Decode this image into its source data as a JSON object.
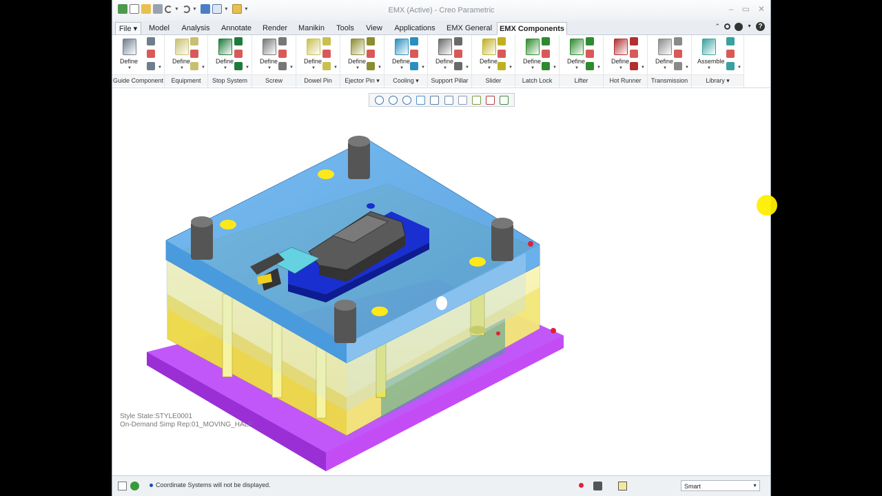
{
  "window": {
    "title": "EMX (Active) - Creo Parametric",
    "controls": [
      "–",
      "▭",
      "✕"
    ]
  },
  "quick_access": {
    "icons": [
      "app-icon",
      "new-icon",
      "open-icon",
      "save-icon",
      "undo-icon",
      "redo-icon",
      "regenerate-icon",
      "windows-icon",
      "close-window-icon",
      "customize-icon"
    ]
  },
  "menu_tabs": [
    {
      "label": "File ▾"
    },
    {
      "label": "Model"
    },
    {
      "label": "Analysis"
    },
    {
      "label": "Annotate"
    },
    {
      "label": "Render"
    },
    {
      "label": "Manikin"
    },
    {
      "label": "Tools"
    },
    {
      "label": "View"
    },
    {
      "label": "Applications"
    },
    {
      "label": "EMX General"
    },
    {
      "label": "EMX Components"
    }
  ],
  "active_tab": "EMX Components",
  "help": {
    "icons": [
      "minimize-ribbon-icon",
      "search-icon",
      "community-icon",
      "help-icon"
    ],
    "help_glyph": "?"
  },
  "ribbon": {
    "groups": [
      {
        "label": "Guide Component",
        "button": "Define",
        "color": "#6f7e8e"
      },
      {
        "label": "Equipment",
        "button": "Define",
        "color": "#c8c070"
      },
      {
        "label": "Stop System",
        "button": "Define",
        "color": "#1e7a3a"
      },
      {
        "label": "Screw",
        "button": "Define",
        "color": "#777777"
      },
      {
        "label": "Dowel Pin",
        "button": "Define",
        "color": "#c8c050"
      },
      {
        "label": "Ejector Pin ▾",
        "button": "Define",
        "color": "#8c8c30"
      },
      {
        "label": "Cooling ▾",
        "button": "Define",
        "color": "#2a8fbf"
      },
      {
        "label": "Support Pillar",
        "button": "Define",
        "color": "#6a6a6a"
      },
      {
        "label": "Slider",
        "button": "Define",
        "color": "#c0b020"
      },
      {
        "label": "Latch Lock",
        "button": "Define",
        "color": "#2e8a2e"
      },
      {
        "label": "Lifter",
        "button": "Define",
        "color": "#2e8a2e"
      },
      {
        "label": "Hot Runner",
        "button": "Define",
        "color": "#b03030"
      },
      {
        "label": "Transmission",
        "button": "Define",
        "color": "#8a8a8a"
      },
      {
        "label": "Library ▾",
        "button": "Assemble",
        "color": "#3aa0a0"
      }
    ]
  },
  "view_toolbar": {
    "icons": [
      "refit-icon",
      "zoom-in-icon",
      "zoom-out-icon",
      "repaint-icon",
      "display-style-icon",
      "saved-orientations-icon",
      "named-views-icon",
      "datum-display-icon",
      "spin-center-icon",
      "annotation-display-icon"
    ]
  },
  "viewport": {
    "style_state": "Style State:STYLE0001",
    "simp_rep": "On-Demand Simp Rep:01_MOVING_HALF"
  },
  "status": {
    "message": "Coordinate Systems will not be displayed.",
    "filter": "Smart"
  }
}
